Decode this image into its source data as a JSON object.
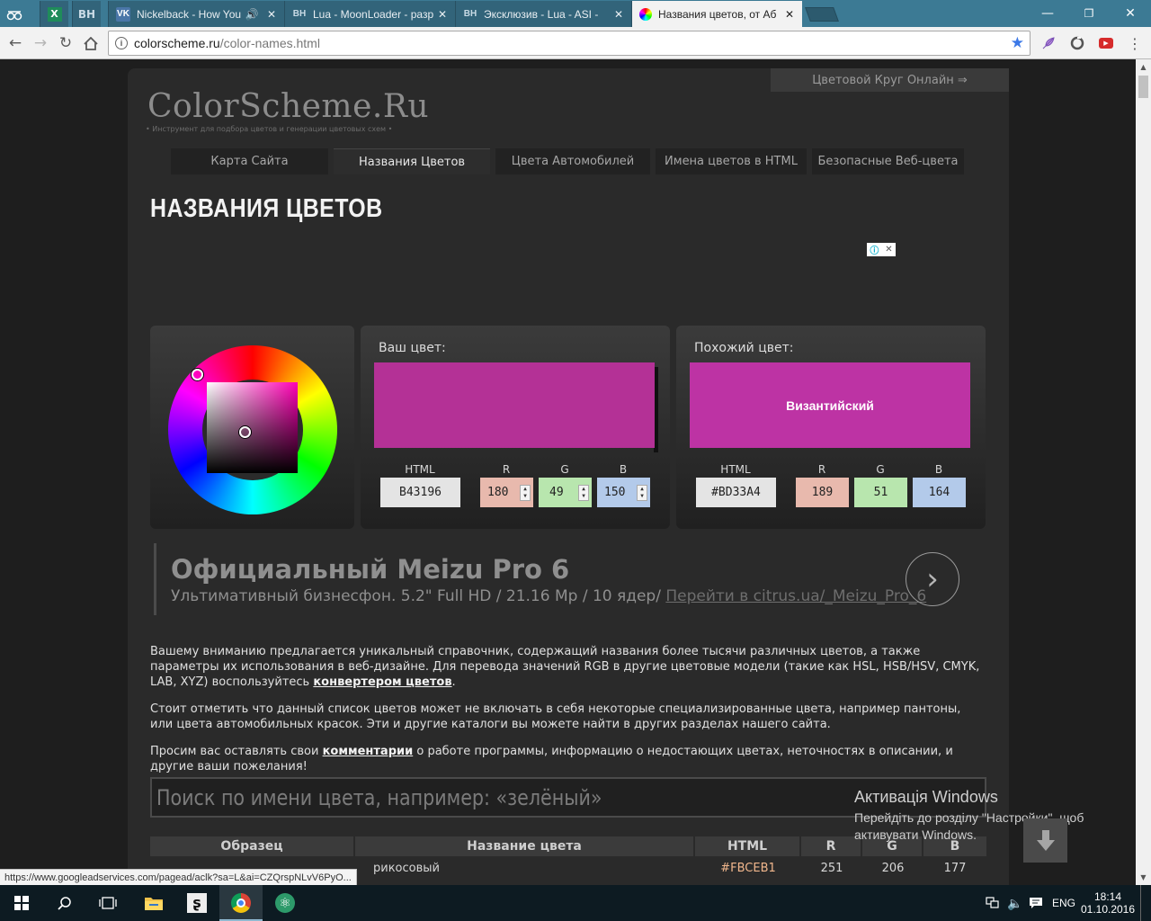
{
  "browser": {
    "tabs": [
      {
        "title": "Nickelback - How You",
        "favicon": "VK"
      },
      {
        "title": "Lua - MoonLoader - разр",
        "favicon": "BH"
      },
      {
        "title": "Эксклюзив - Lua - ASI -",
        "favicon": "BH"
      },
      {
        "title": "Названия цветов, от Аб",
        "favicon": "color-wheel",
        "active": true
      }
    ],
    "pinned": [
      {
        "favicon": "BH"
      }
    ],
    "address": {
      "domain": "colorscheme.ru",
      "path": "/color-names.html"
    }
  },
  "site": {
    "name": "ColorScheme.Ru",
    "tagline": "• Инструмент для подбора цветов и генерации цветовых схем •",
    "circle_link": "Цветовой Круг Онлайн ⇒",
    "nav": [
      "Карта Сайта",
      "Названия Цветов",
      "Цвета Автомобилей",
      "Имена цветов в HTML",
      "Безопасные Веб-цвета"
    ],
    "active_nav": 1,
    "heading": "НАЗВАНИЯ ЦВЕТОВ"
  },
  "picker": {
    "your_label": "Ваш цвет:",
    "similar_label": "Похожий цвет:",
    "col_html": "HTML",
    "col_r": "R",
    "col_g": "G",
    "col_b": "B",
    "your": {
      "html": "B43196",
      "r": "180",
      "g": "49",
      "b": "150",
      "color": "#B43196"
    },
    "similar": {
      "html": "#BD33A4",
      "r": "189",
      "g": "51",
      "b": "164",
      "color": "#BD33A4",
      "name": "Византийский"
    }
  },
  "ad": {
    "title": "Официальный Meizu Pro 6",
    "desc": "Ультимативный бизнесфон. 5.2\" Full HD / 21.16 Mp / 10 ядер/",
    "link": "Перейти в citrus.ua/_Meizu_Pro_6"
  },
  "intro": {
    "p1_text": "Вашему вниманию предлагается уникальный справочник, содержащий названия более тысячи различных цветов, а также параметры их использования в веб-дизайне. Для перевода значений RGB в другие цветовые модели (такие как HSL, HSB/HSV, CMYK, LAB, XYZ) воспользуйтесь",
    "p1_link": "конвертером цветов",
    "p2_text": "Стоит отметить что данный список цветов может не включать в себя некоторые специализированные цвета, например пантоны, или цвета автомобильных красок. Эти и другие каталоги вы можете найти в других разделах нашего сайта.",
    "p3_pre": "Просим вас оставлять свои",
    "p3_link": "комментарии",
    "p3_post": "о работе программы, информацию о недостающих цветах, неточностях в описании, и другие ваши пожелания!"
  },
  "search": {
    "placeholder": "Поиск по имени цвета, например: «зелёный»"
  },
  "table": {
    "headers": [
      "Образец",
      "Название цвета",
      "HTML",
      "R",
      "G",
      "B"
    ],
    "rows": [
      {
        "name": "рикосовый",
        "html": "#FBCEB1",
        "r": "251",
        "g": "206",
        "b": "177"
      }
    ]
  },
  "status_url": "https://www.googleadservices.com/pagead/aclk?sa=L&ai=CZQrspNLvV6PyO...",
  "activation": {
    "title": "Активація Windows",
    "line1": "Перейдіть до розділу \"Настройки\", щоб",
    "line2": "активувати Windows."
  },
  "taskbar": {
    "lang": "ENG",
    "time": "18:14",
    "date": "01.10.2016"
  },
  "colors": {
    "tabbar": "#3c7a94",
    "page_bg": "#2a2a2a",
    "your_color": "#B43196",
    "similar_color": "#BD33A4"
  }
}
